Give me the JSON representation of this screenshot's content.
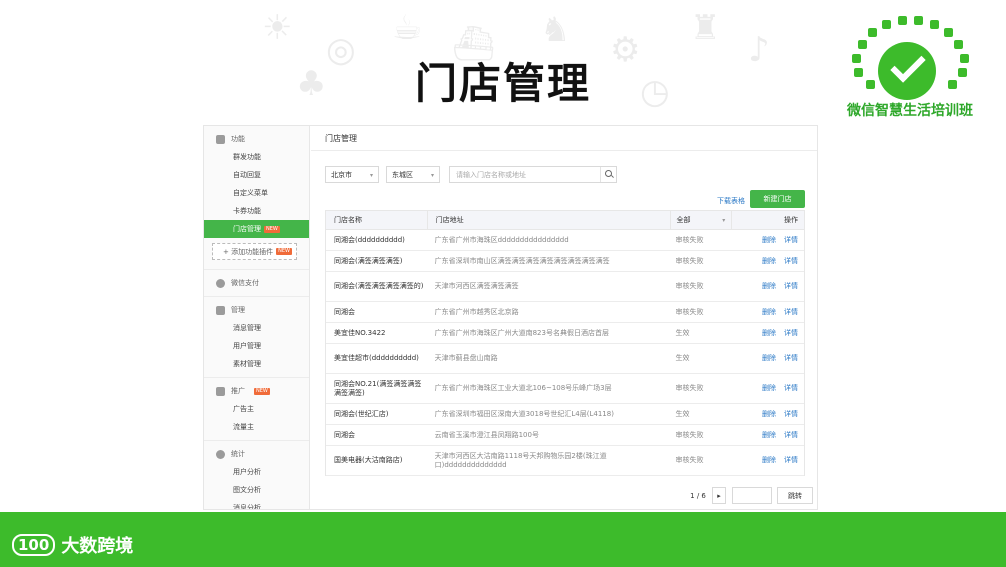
{
  "slide": {
    "title": "门店管理",
    "logo_text": "微信智慧生活培训班",
    "footer_brand_mark": "100",
    "footer_brand": "大数跨境"
  },
  "sidebar": {
    "groups": [
      {
        "title": "功能",
        "icon": "grid-icon",
        "items": [
          "群发功能",
          "自动回复",
          "自定义菜单",
          "卡券功能",
          "门店管理"
        ],
        "active_index": 4,
        "active_badge": "NEW",
        "add_plugin_label": "+ 添加功能插件",
        "add_plugin_badge": "NEW"
      },
      {
        "title": "微信支付",
        "icon": "wechat-pay-icon",
        "items": []
      },
      {
        "title": "管理",
        "icon": "folder-icon",
        "items": [
          "消息管理",
          "用户管理",
          "素材管理"
        ]
      },
      {
        "title": "推广",
        "icon": "megaphone-icon",
        "badge": "NEW",
        "items": [
          "广告主",
          "流量主"
        ]
      },
      {
        "title": "统计",
        "icon": "chart-icon",
        "items": [
          "用户分析",
          "图文分析",
          "消息分析"
        ]
      }
    ]
  },
  "main": {
    "title": "门店管理",
    "filters": {
      "city": "北京市",
      "district": "东城区",
      "search_placeholder": "请输入门店名称或地址"
    },
    "download_label": "下载表格",
    "new_store_label": "新建门店",
    "table": {
      "headers": [
        "门店名称",
        "门店地址",
        "全部",
        "操作"
      ],
      "rows": [
        {
          "name": "同湘会(dddddddddd)",
          "address": "广东省广州市海珠区dddddddddddddddd",
          "status": "审核失败"
        },
        {
          "name": "同湘会(满签满签满签)",
          "address": "广东省深圳市南山区满签满签满签满签满签满签满签满签",
          "status": "审核失败"
        },
        {
          "name": "同湘会(满签满签满签满签的)",
          "address": "天津市河西区满签满签满签",
          "status": "审核失败"
        },
        {
          "name": "同湘会",
          "address": "广东省广州市越秀区北京路",
          "status": "审核失败"
        },
        {
          "name": "美宜佳NO.3422",
          "address": "广东省广州市海珠区广州大道南823号名典假日酒店首层",
          "status": "生效"
        },
        {
          "name": "美宜佳超市(dddddddddd)",
          "address": "天津市蓟县盘山南路",
          "status": "生效"
        },
        {
          "name": "同湘会NO.21(满签满签满签满签满签)",
          "address": "广东省广州市海珠区工业大道北106~108号乐峰广场3层",
          "status": "审核失败"
        },
        {
          "name": "同湘会(世纪汇店)",
          "address": "广东省深圳市福田区深南大道3018号世纪汇L4层(L4118)",
          "status": "生效"
        },
        {
          "name": "同湘会",
          "address": "云南省玉溪市澄江县凤翔路100号",
          "status": "审核失败"
        },
        {
          "name": "国美电器(大沽南路店)",
          "address": "天津市河西区大沽南路1118号天邦购物乐园2楼(珠江道口)dddddddddddddd",
          "status": "审核失败"
        }
      ],
      "ops": {
        "delete": "删除",
        "detail": "详情"
      }
    },
    "pagination": {
      "page": "1 / 6",
      "next": "▸",
      "goto_value": "",
      "jump_label": "跳转"
    }
  }
}
